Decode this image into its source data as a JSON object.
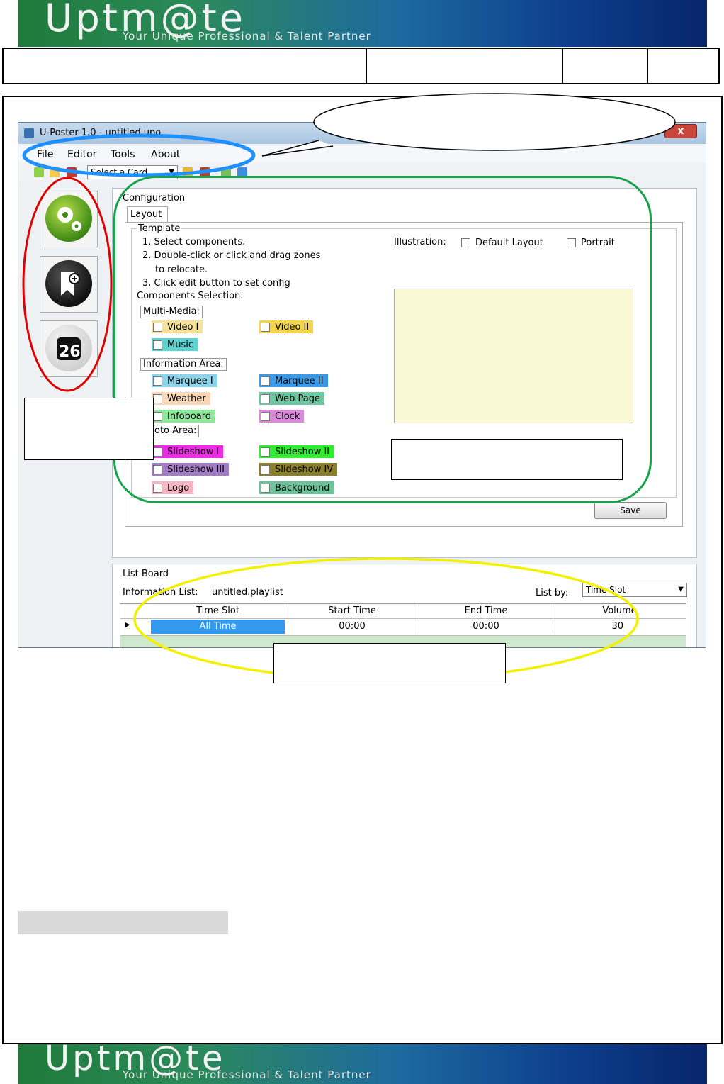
{
  "banner": {
    "logo_text": "Uptm@te",
    "tagline": "Your Unique Professional & Talent Partner"
  },
  "window": {
    "title": "U-Poster 1.0 - untitled.upo",
    "close_label": "x"
  },
  "menu": {
    "file": "File",
    "editor": "Editor",
    "tools": "Tools",
    "about": "About"
  },
  "toolbar": {
    "card_select": "Select a Card"
  },
  "sidebar": {
    "calendar_day": "26"
  },
  "configuration": {
    "group_title": "Configuration",
    "tab_layout": "Layout",
    "template_title": "Template",
    "steps": [
      "1. Select components.",
      "2. Double-click or click and drag zones",
      "to relocate.",
      "3. Click edit button to set config"
    ],
    "components_selection": "Components Selection:",
    "illustration_label": "Illustration:",
    "default_layout": "Default Layout",
    "portrait": "Portrait",
    "multimedia_title": "Multi-Media:",
    "information_title": "Information Area:",
    "photo_title": "oto Area:",
    "components": {
      "video1": "Video I",
      "video2": "Video II",
      "music": "Music",
      "marquee1": "Marquee I",
      "marquee2": "Marquee II",
      "weather": "Weather",
      "webpage": "Web Page",
      "infoboard": "Infoboard",
      "clock": "Clock",
      "slideshow1": "Slideshow I",
      "slideshow2": "Slideshow II",
      "slideshow3": "Slideshow III",
      "slideshow4": "Slideshow IV",
      "logo": "Logo",
      "background": "Background"
    },
    "save_label": "Save"
  },
  "listboard": {
    "group_title": "List Board",
    "info_list_label": "Information List:",
    "info_list_value": "untitled.playlist",
    "list_by_label": "List by:",
    "list_by_value": "Time Slot",
    "columns": [
      "Time Slot",
      "Start Time",
      "End Time",
      "Volume"
    ],
    "rows": [
      {
        "time_slot": "All Time",
        "start": "00:00",
        "end": "00:00",
        "volume": "30"
      }
    ]
  },
  "colors": {
    "menu_highlight": "#1e90ff",
    "sidebar_highlight": "#e00000",
    "config_highlight": "#16a34a",
    "list_highlight": "#f2f200",
    "video1": "#f5e29a",
    "video2": "#f5d54a",
    "music": "#5fd3cf",
    "marquee1": "#8dd4ea",
    "marquee2": "#3a9ae8",
    "weather": "#f8d7b8",
    "webpage": "#6cc7a0",
    "infoboard": "#8ee89a",
    "clock": "#d98ad8",
    "slideshow1": "#ee2be6",
    "slideshow2": "#2fee2f",
    "slideshow3": "#a47cc6",
    "slideshow4": "#8a7f2a",
    "logo": "#f6b5c0",
    "background": "#6cc29a"
  }
}
